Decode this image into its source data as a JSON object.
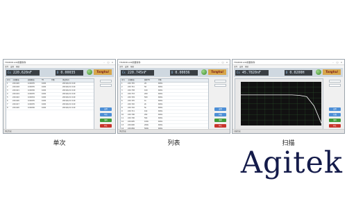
{
  "panels": [
    {
      "caption": "单次",
      "window_title": "TH2838 LCR测量软件",
      "menu": [
        "文件",
        "设置",
        "帮助"
      ],
      "readout": {
        "label1": "Cs",
        "value1": "220.620nF",
        "label2": "D",
        "value2": "0.00035"
      },
      "logo_text": "Tonghui",
      "table": {
        "headers": [
          "序号",
          "主参数值",
          "副参数值",
          "Hz",
          "判断",
          "测试时间"
        ],
        "rows": [
          [
            "1",
            "220.620",
            "0.00035",
            "1000",
            "",
            "2019/4/21 9:40"
          ],
          [
            "2",
            "220.618",
            "0.00035",
            "1000",
            "",
            "2019/4/21 9:40"
          ],
          [
            "3",
            "220.621",
            "0.00036",
            "1000",
            "",
            "2019/4/21 9:40"
          ],
          [
            "4",
            "220.619",
            "0.00035",
            "1000",
            "",
            "2019/4/21 9:40"
          ],
          [
            "5",
            "220.622",
            "0.00034",
            "1000",
            "",
            "2019/4/21 9:40"
          ],
          [
            "6",
            "220.620",
            "0.00035",
            "1000",
            "",
            "2019/4/21 9:40"
          ],
          [
            "7",
            "220.617",
            "0.00035",
            "1000",
            "",
            "2019/4/21 9:40"
          ],
          [
            "8",
            "220.620",
            "0.00036",
            "1000",
            "",
            "2019/4/21 9:40"
          ]
        ]
      },
      "side_buttons": [
        "设置",
        "单次",
        "清除",
        "停止"
      ],
      "status": "测试完成"
    },
    {
      "caption": "列表",
      "window_title": "TH2838 LCR测量软件",
      "menu": [
        "文件",
        "设置",
        "帮助"
      ],
      "readout": {
        "label1": "Cs",
        "value1": "220.745nF",
        "label2": "D",
        "value2": "0.00036"
      },
      "logo_text": "Tonghui",
      "table": {
        "headers": [
          "序号",
          "主参数值",
          "频率Hz",
          "判断"
        ],
        "rows": [
          [
            "1",
            "220.745",
            "20",
            "PASS"
          ],
          [
            "2",
            "220.741",
            "50",
            "PASS"
          ],
          [
            "3",
            "220.738",
            "100",
            "PASS"
          ],
          [
            "4",
            "220.733",
            "200",
            "PASS"
          ],
          [
            "5",
            "220.729",
            "500",
            "PASS"
          ],
          [
            "6",
            "220.725",
            "1k",
            "PASS"
          ],
          [
            "7",
            "220.720",
            "2k",
            "PASS"
          ],
          [
            "8",
            "220.716",
            "5k",
            "PASS"
          ],
          [
            "9",
            "220.711",
            "10k",
            "PASS"
          ],
          [
            "10",
            "220.706",
            "20k",
            "PASS"
          ],
          [
            "11",
            "220.700",
            "50k",
            "PASS"
          ],
          [
            "12",
            "220.695",
            "100k",
            "PASS"
          ],
          [
            "13",
            "220.690",
            "200k",
            "PASS"
          ],
          [
            "14",
            "220.684",
            "500k",
            "PASS"
          ],
          [
            "15",
            "220.679",
            "1M",
            "PASS"
          ]
        ]
      },
      "side_buttons": [
        "设置",
        "列表",
        "清除",
        "停止"
      ],
      "status": "测试完成"
    },
    {
      "caption": "扫描",
      "window_title": "TH2838 LCR测量软件",
      "menu": [
        "文件",
        "设置",
        "帮助"
      ],
      "readout": {
        "label1": "Cs",
        "value1": "45.7820nF",
        "label2": "D",
        "value2": "0.0200H"
      },
      "logo_text": "Tonghui",
      "sweep": {
        "curve_y": [
          0.3,
          0.3,
          0.3,
          0.3,
          0.3,
          0.3,
          0.3,
          0.3,
          0.31,
          0.34,
          0.55,
          0.95
        ]
      },
      "side_buttons": [
        "设置",
        "扫描",
        "清除",
        "停止"
      ],
      "status": "扫描完成"
    }
  ],
  "brand": "Agitek",
  "colors": {
    "btn_blue": "#4d8fd6",
    "btn_green": "#3f9b3a",
    "btn_red": "#c9342c",
    "curve": "#ffffff"
  }
}
